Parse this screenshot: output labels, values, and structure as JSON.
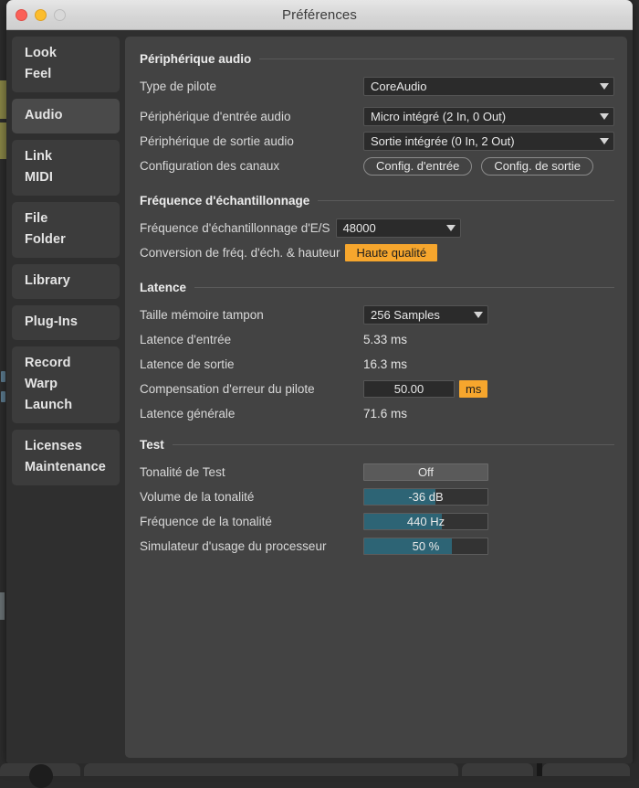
{
  "window": {
    "title": "Préférences",
    "traffic_lights": [
      "close-red",
      "minimize-yellow",
      "zoom-grey"
    ]
  },
  "sidebar": {
    "groups": [
      {
        "selected": false,
        "items": [
          "Look",
          "Feel"
        ]
      },
      {
        "selected": true,
        "items": [
          "Audio"
        ]
      },
      {
        "selected": false,
        "items": [
          "Link",
          "MIDI"
        ]
      },
      {
        "selected": false,
        "items": [
          "File",
          "Folder"
        ]
      },
      {
        "selected": false,
        "items": [
          "Library"
        ]
      },
      {
        "selected": false,
        "items": [
          "Plug-Ins"
        ]
      },
      {
        "selected": false,
        "items": [
          "Record",
          "Warp",
          "Launch"
        ]
      },
      {
        "selected": false,
        "items": [
          "Licenses",
          "Maintenance"
        ]
      }
    ]
  },
  "sections": {
    "audio_device": {
      "title": "Périphérique audio",
      "driver_type_label": "Type de pilote",
      "driver_type_value": "CoreAudio",
      "input_device_label": "Périphérique d'entrée audio",
      "input_device_value": "Micro intégré (2 In, 0 Out)",
      "output_device_label": "Périphérique de sortie audio",
      "output_device_value": "Sortie intégrée (0 In, 2 Out)",
      "channel_config_label": "Configuration des canaux",
      "input_config_button": "Config. d'entrée",
      "output_config_button": "Config. de sortie"
    },
    "sample_rate": {
      "title": "Fréquence d'échantillonnage",
      "io_rate_label": "Fréquence d'échantillonnage d'E/S",
      "io_rate_value": "48000",
      "conversion_label": "Conversion de fréq. d'éch. & hauteur",
      "conversion_value": "Haute qualité"
    },
    "latency": {
      "title": "Latence",
      "buffer_size_label": "Taille mémoire tampon",
      "buffer_size_value": "256 Samples",
      "input_latency_label": "Latence d'entrée",
      "input_latency_value": "5.33 ms",
      "output_latency_label": "Latence de sortie",
      "output_latency_value": "16.3 ms",
      "driver_error_label": "Compensation d'erreur du pilote",
      "driver_error_value": "50.00",
      "driver_error_unit": "ms",
      "overall_latency_label": "Latence générale",
      "overall_latency_value": "71.6 ms"
    },
    "test": {
      "title": "Test",
      "test_tone_label": "Tonalité de Test",
      "test_tone_value": "Off",
      "tone_volume_label": "Volume de la tonalité",
      "tone_volume_value": "-36 dB",
      "tone_volume_fill_pct": 58,
      "tone_frequency_label": "Fréquence de la tonalité",
      "tone_frequency_value": "440 Hz",
      "tone_frequency_fill_pct": 63,
      "cpu_usage_label": "Simulateur d'usage du processeur",
      "cpu_usage_value": "50 %",
      "cpu_usage_fill_pct": 71
    }
  },
  "colors": {
    "accent_orange": "#f6a62d",
    "slider_teal": "#2d6475",
    "panel_bg": "#434343",
    "sidebar_bg": "#3c3c3c",
    "sidebar_selected_bg": "#4a4a4a"
  }
}
